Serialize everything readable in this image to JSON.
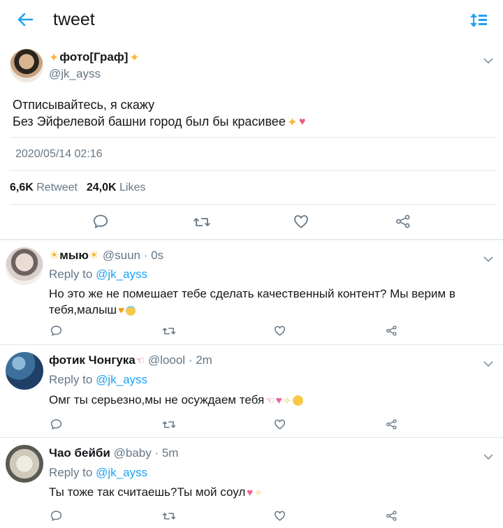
{
  "header": {
    "title": "tweet"
  },
  "tweet": {
    "author_name": "фото[Граф]",
    "author_handle": "@jk_ayss",
    "text_line1": "Отписывайтесь, я скажу",
    "text_line2": "Без Эйфелевой башни город был бы красивее",
    "timestamp": "2020/05/14 02:16",
    "retweet_count": "6,6K",
    "retweet_label": "Retweet",
    "like_count": "24,0K",
    "like_label": "Likes"
  },
  "replies": [
    {
      "name": "мыю",
      "handle": "@suun",
      "time": "· 0s",
      "reply_prefix": "Reply to",
      "reply_to": "@jk_ayss",
      "text_line1": "Но это же не помешает тебе сделать качественный контент? Мы верим в",
      "text_line2": "тебя,малыш"
    },
    {
      "name": "фотик Чонгука",
      "handle": "@loool",
      "time": "· 2m",
      "reply_prefix": "Reply to",
      "reply_to": "@jk_ayss",
      "text_line1": "Омг ты серьезно,мы не осуждаем тебя"
    },
    {
      "name": "Чао бейби",
      "handle": "@baby",
      "time": "· 5m",
      "reply_prefix": "Reply to",
      "reply_to": "@jk_ayss",
      "text_line1": "Ты тоже так считаешь?Ты мой соул"
    }
  ],
  "colors": {
    "accent": "#1da1f2",
    "secondary_text": "#657786",
    "divider": "#e1e8ed"
  }
}
